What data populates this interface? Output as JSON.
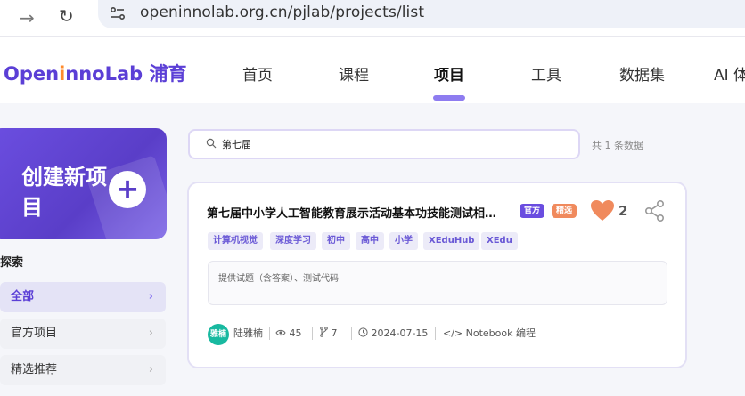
{
  "browser": {
    "url": "openinnolab.org.cn/pjlab/projects/list"
  },
  "logo": {
    "part1": "Open",
    "part2": "i",
    "part3": "nnoLab",
    "part4": " 浦育"
  },
  "nav": {
    "items": [
      {
        "label": "首页"
      },
      {
        "label": "课程"
      },
      {
        "label": "项目"
      },
      {
        "label": "工具"
      },
      {
        "label": "数据集"
      },
      {
        "label": "AI 体"
      }
    ],
    "active": "项目"
  },
  "sidebar": {
    "create_label": "创建新项目",
    "create_icon": "plus-icon",
    "section_title": "探索",
    "items": [
      {
        "label": "全部"
      },
      {
        "label": "官方项目"
      },
      {
        "label": "精选推荐"
      }
    ]
  },
  "search": {
    "value": "第七届",
    "result_count": "共 1 条数据"
  },
  "project": {
    "title": "第七届中小学人工智能教育展示活动基本功技能测试相关资源",
    "badges": [
      "官方",
      "精选"
    ],
    "likes": "2",
    "tags": [
      "计算机视觉",
      "深度学习",
      "初中",
      "高中",
      "小学",
      "XEduHub",
      "XEdu"
    ],
    "description": "提供试题（含答案）、测试代码",
    "author": "陆雅楠",
    "avatar_text": "雅楠",
    "views": "45",
    "forks": "7",
    "date": "2024-07-15",
    "type": "Notebook 编程"
  },
  "colors": {
    "brand": "#5b3fd6",
    "accent": "#ff8a2b",
    "heart": "#f08a5d",
    "tag_text": "#6a59d6"
  }
}
